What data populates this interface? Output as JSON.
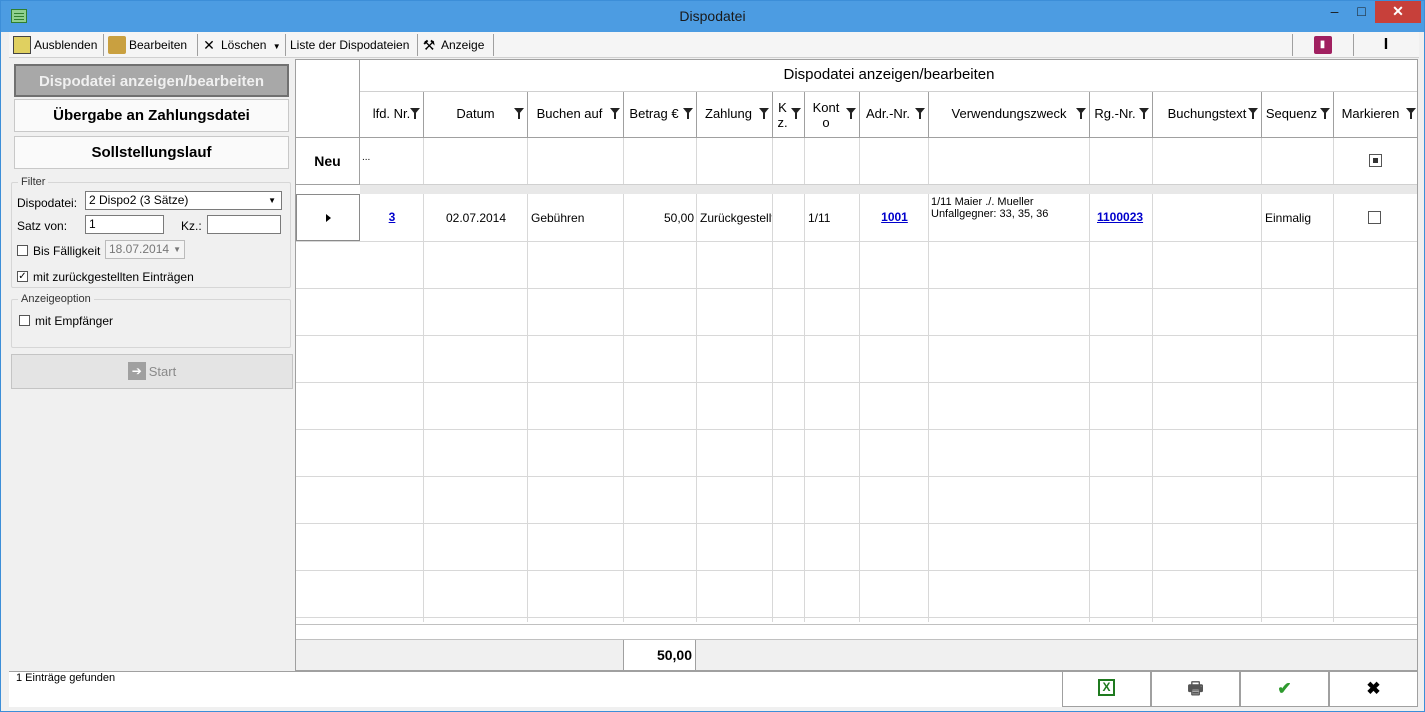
{
  "window": {
    "title": "Dispodatei",
    "controls": {
      "minimize": "–",
      "maximize": "□",
      "close": "✕"
    }
  },
  "toolbar": {
    "hide_label": "Ausblenden",
    "edit_label": "Bearbeiten",
    "delete_label": "Löschen",
    "list_label": "Liste der Dispodateien",
    "view_label": "Anzeige"
  },
  "left": {
    "btn_view_edit": "Dispodatei anzeigen/bearbeiten",
    "btn_transfer": "Übergabe an Zahlungsdatei",
    "btn_debit_run": "Sollstellungslauf",
    "filter": {
      "legend": "Filter",
      "dispo_label": "Dispodatei:",
      "dispo_value": "2  Dispo2 (3 Sätze)",
      "satz_label": "Satz von:",
      "satz_value": "1",
      "kz_label": "Kz.:",
      "kz_value": "",
      "due_label": "Bis Fälligkeit",
      "due_value": "18.07.2014",
      "due_checked": false,
      "deferred_label": "mit zurückgestellten Einträgen",
      "deferred_checked": true
    },
    "display": {
      "legend": "Anzeigeoption",
      "recipient_label": "mit Empfänger",
      "recipient_checked": false
    },
    "start_label": "Start"
  },
  "grid": {
    "caption": "Dispodatei anzeigen/bearbeiten",
    "columns": [
      {
        "label": "lfd. Nr."
      },
      {
        "label": "Datum"
      },
      {
        "label": "Buchen auf"
      },
      {
        "label": "Betrag €"
      },
      {
        "label": "Zahlung"
      },
      {
        "label": "K z."
      },
      {
        "label": "Kont o"
      },
      {
        "label": "Adr.-Nr."
      },
      {
        "label": "Verwendungszweck"
      },
      {
        "label": "Rg.-Nr."
      },
      {
        "label": "Buchungstext"
      },
      {
        "label": "Sequenz"
      },
      {
        "label": "Markieren"
      }
    ],
    "new_row": {
      "label": "Neu",
      "placeholder": "..."
    },
    "rows": [
      {
        "lfd_nr": "3",
        "datum": "02.07.2014",
        "buchen_auf": "Gebühren",
        "betrag": "50,00",
        "zahlung": "Zurückgestellt",
        "kz": "",
        "konto": "1/11",
        "adr_nr": "1001",
        "verwendungszweck_1": "1/11 Maier ./. Mueller",
        "verwendungszweck_2": "Unfallgegner: 33, 35, 36",
        "rg_nr": "1100023",
        "buchungstext": "",
        "sequenz": "Einmalig",
        "markieren": false
      }
    ],
    "sum_betrag": "50,00"
  },
  "status": {
    "text": "1 Einträge gefunden"
  },
  "footer_buttons": {
    "excel": "X",
    "print": "🖶",
    "ok": "✔",
    "cancel": "✖"
  }
}
